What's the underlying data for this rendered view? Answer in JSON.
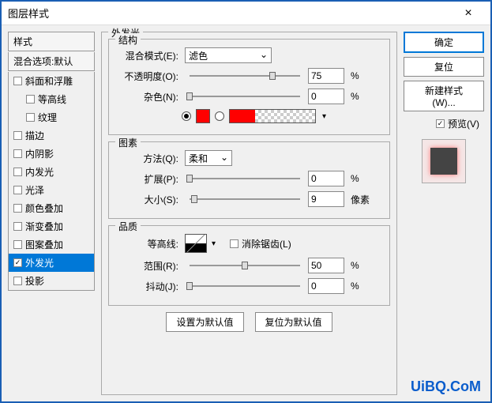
{
  "window": {
    "title": "图层样式",
    "close": "×"
  },
  "sidebar": {
    "styles_header": "样式",
    "blend_header": "混合选项:默认",
    "items": [
      {
        "key": "bevel",
        "label": "斜面和浮雕",
        "checked": false,
        "selected": false,
        "indent": 0
      },
      {
        "key": "contour",
        "label": "等高线",
        "checked": false,
        "selected": false,
        "indent": 1
      },
      {
        "key": "texture",
        "label": "纹理",
        "checked": false,
        "selected": false,
        "indent": 1
      },
      {
        "key": "stroke",
        "label": "描边",
        "checked": false,
        "selected": false,
        "indent": 0
      },
      {
        "key": "inner-shadow",
        "label": "内阴影",
        "checked": false,
        "selected": false,
        "indent": 0
      },
      {
        "key": "inner-glow",
        "label": "内发光",
        "checked": false,
        "selected": false,
        "indent": 0
      },
      {
        "key": "satin",
        "label": "光泽",
        "checked": false,
        "selected": false,
        "indent": 0
      },
      {
        "key": "color-overlay",
        "label": "颜色叠加",
        "checked": false,
        "selected": false,
        "indent": 0
      },
      {
        "key": "gradient-overlay",
        "label": "渐变叠加",
        "checked": false,
        "selected": false,
        "indent": 0
      },
      {
        "key": "pattern-overlay",
        "label": "图案叠加",
        "checked": false,
        "selected": false,
        "indent": 0
      },
      {
        "key": "outer-glow",
        "label": "外发光",
        "checked": true,
        "selected": true,
        "indent": 0
      },
      {
        "key": "drop-shadow",
        "label": "投影",
        "checked": false,
        "selected": false,
        "indent": 0
      }
    ]
  },
  "panel": {
    "title": "外发光",
    "structure": {
      "title": "结构",
      "blend_mode_label": "混合模式(E):",
      "blend_mode_value": "滤色",
      "opacity_label": "不透明度(O):",
      "opacity_value": "75",
      "opacity_unit": "%",
      "noise_label": "杂色(N):",
      "noise_value": "0",
      "noise_unit": "%",
      "solid_color": "#ff0000"
    },
    "elements_group": {
      "title": "图素",
      "technique_label": "方法(Q):",
      "technique_value": "柔和",
      "spread_label": "扩展(P):",
      "spread_value": "0",
      "spread_unit": "%",
      "size_label": "大小(S):",
      "size_value": "9",
      "size_unit": "像素"
    },
    "quality": {
      "title": "品质",
      "contour_label": "等高线:",
      "antialias_label": "消除锯齿(L)",
      "antialias_checked": false,
      "range_label": "范围(R):",
      "range_value": "50",
      "range_unit": "%",
      "jitter_label": "抖动(J):",
      "jitter_value": "0",
      "jitter_unit": "%"
    },
    "buttons": {
      "make_default": "设置为默认值",
      "reset_default": "复位为默认值"
    }
  },
  "right": {
    "ok": "确定",
    "cancel": "复位",
    "new_style": "新建样式(W)...",
    "preview_label": "预览(V)",
    "preview_checked": true
  },
  "watermark": "UiBQ.CoM"
}
